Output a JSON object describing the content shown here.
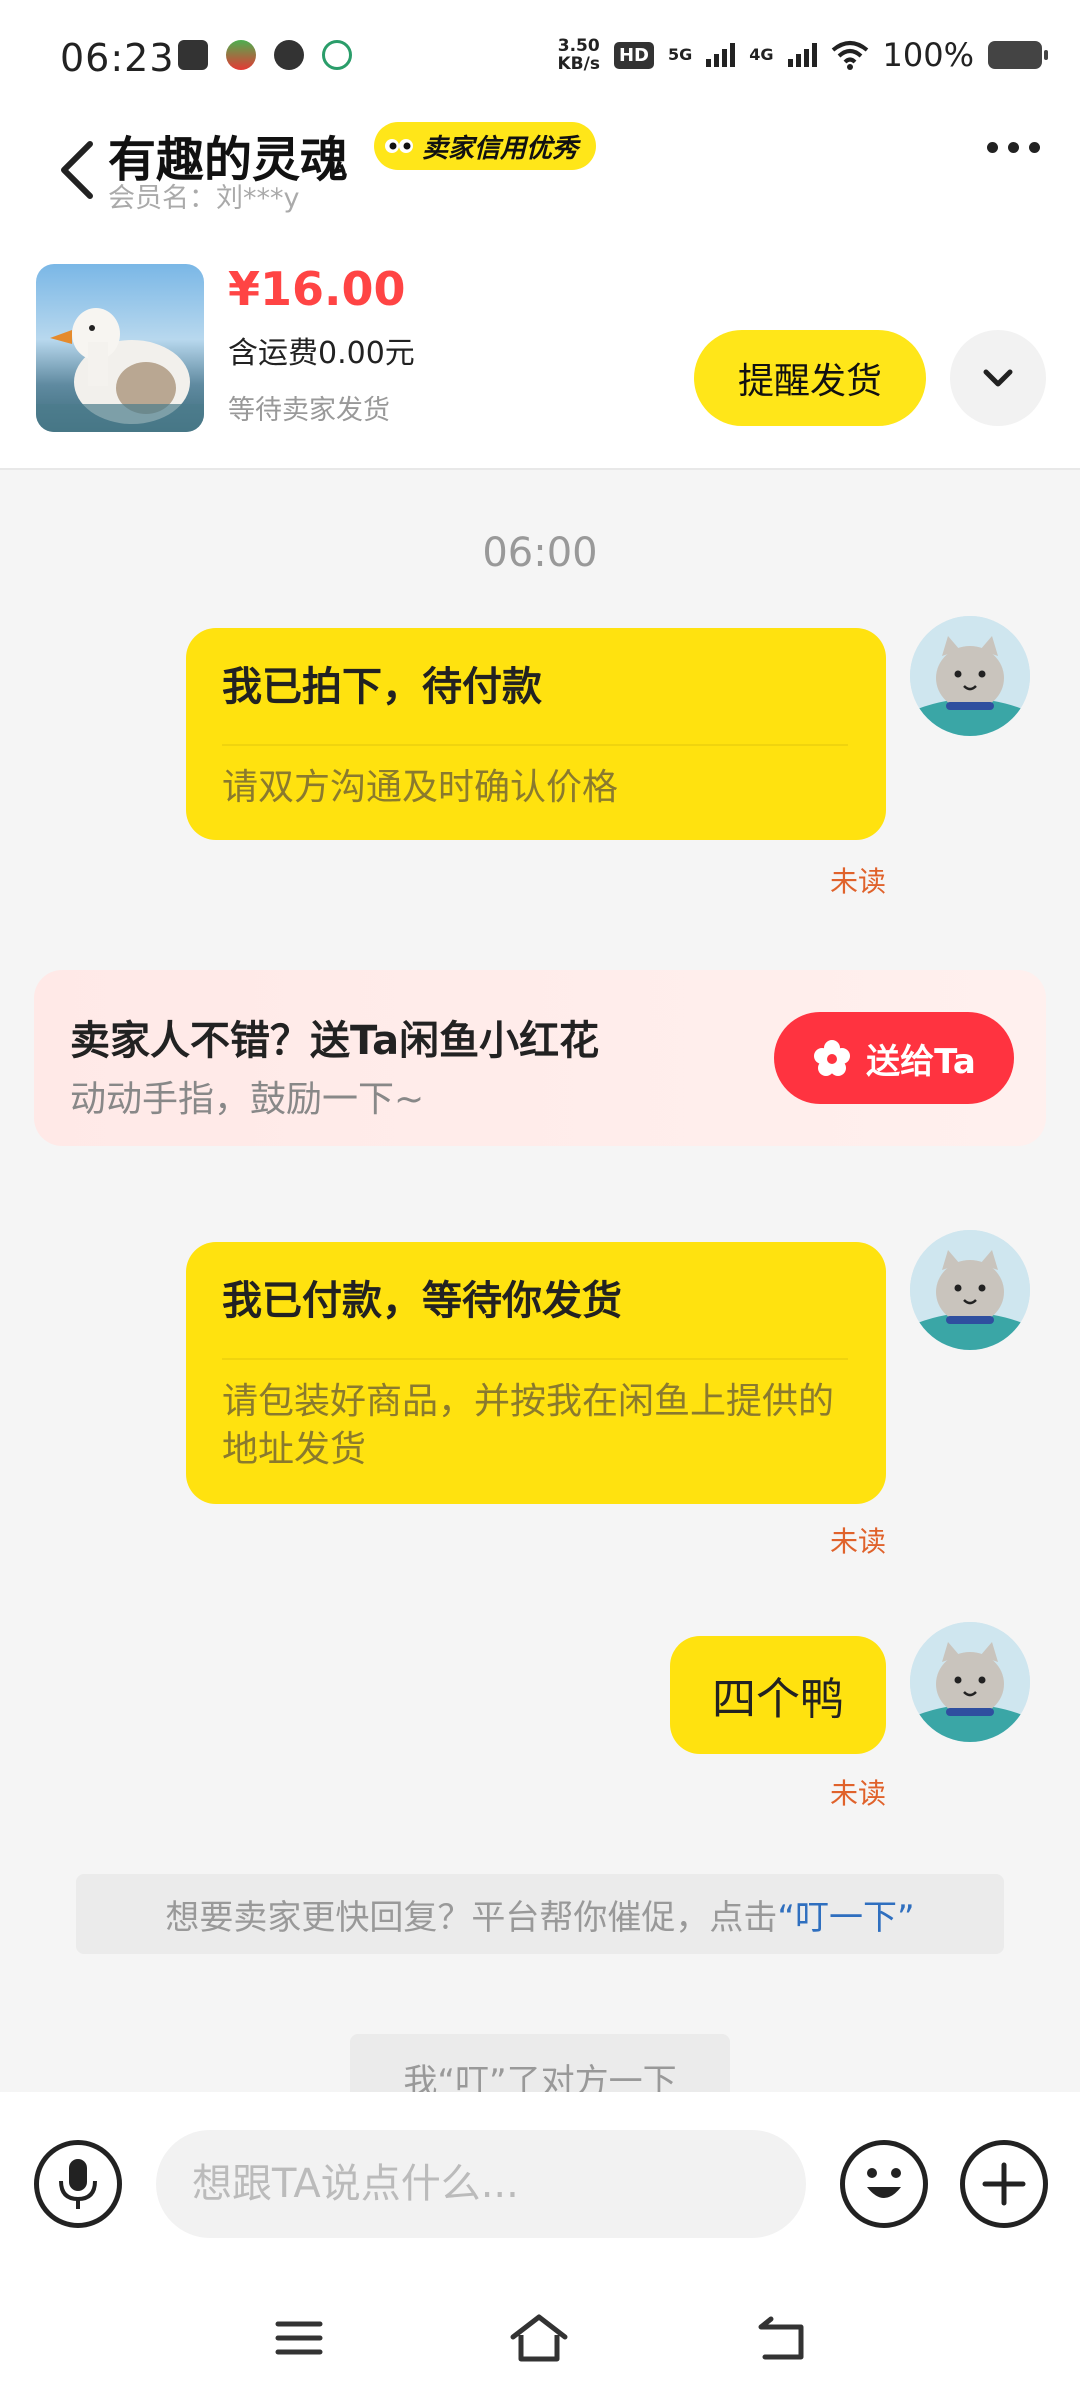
{
  "status_bar": {
    "time": "06:23",
    "net_speed_value": "3.50",
    "net_speed_unit": "KB/s",
    "hd_label": "HD",
    "signal_1": "5G",
    "signal_2": "4G",
    "battery": "100%"
  },
  "header": {
    "title": "有趣的灵魂",
    "badge": "卖家信用优秀",
    "member": "会员名：刘***y"
  },
  "product": {
    "price": "¥16.00",
    "shipping": "含运费0.00元",
    "status": "等待卖家发货",
    "remind_button": "提醒发货"
  },
  "chat": {
    "timestamp": "06:00",
    "messages": [
      {
        "title": "我已拍下，待付款",
        "body": "请双方沟通及时确认价格",
        "status": "未读"
      },
      {
        "title": "我已付款，等待你发货",
        "body": "请包装好商品，并按我在闲鱼上提供的地址发货",
        "status": "未读"
      },
      {
        "text": "四个鸭",
        "status": "未读"
      }
    ],
    "promo": {
      "title": "卖家人不错？送Ta闲鱼小红花",
      "subtitle": "动动手指，鼓励一下~",
      "button": "送给Ta"
    },
    "system_tip": {
      "text": "想要卖家更快回复？平台帮你催促，点击",
      "link": "“叮一下”"
    },
    "system_tip2": "我“叮”了对方一下"
  },
  "input": {
    "placeholder": "想跟TA说点什么..."
  },
  "colors": {
    "accent_yellow": "#ffe20f",
    "price_red": "#ff4444",
    "unread_orange": "#e0622b",
    "link_blue": "#2f6fbf"
  }
}
